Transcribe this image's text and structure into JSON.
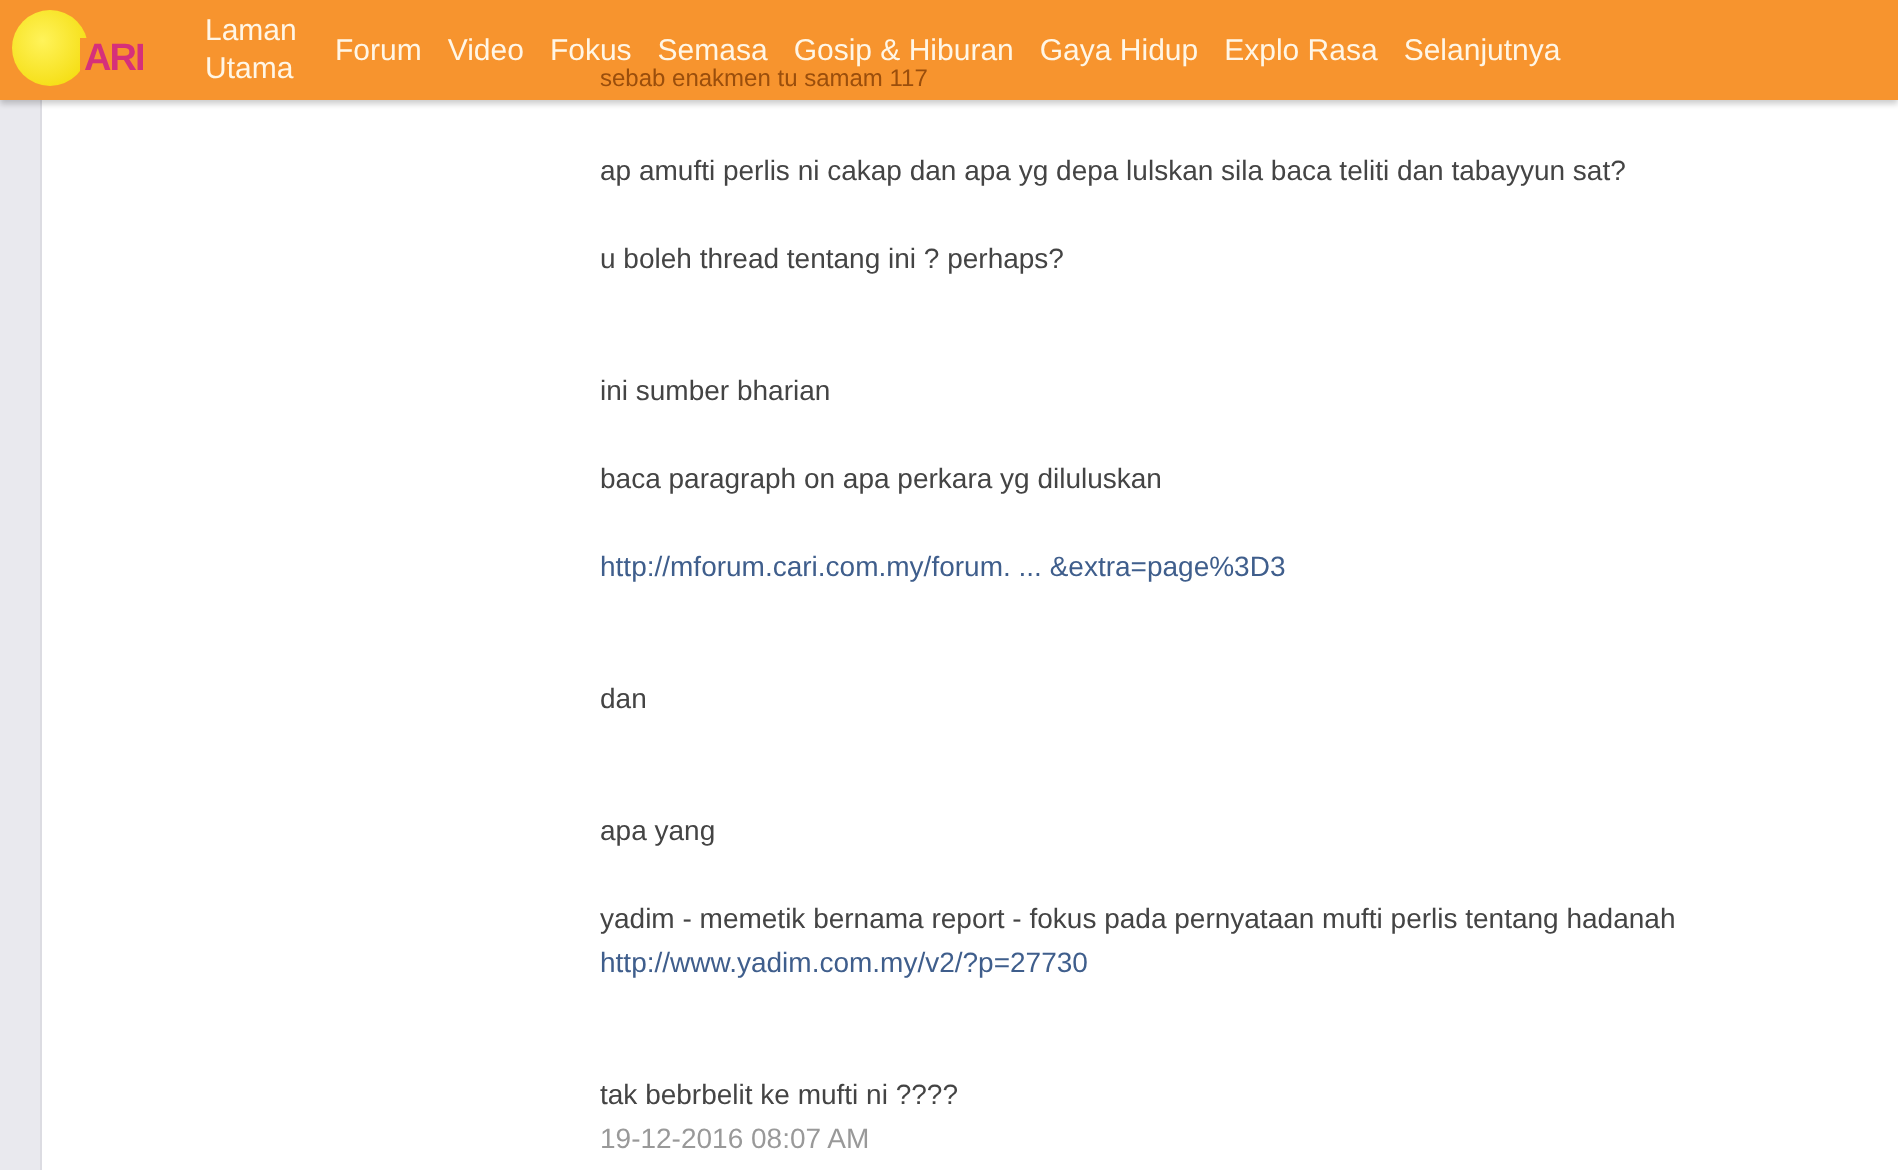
{
  "header": {
    "logo_text": "ARI",
    "nav": [
      {
        "label": "Laman Utama"
      },
      {
        "label": "Forum"
      },
      {
        "label": "Video"
      },
      {
        "label": "Fokus"
      },
      {
        "label": "Semasa"
      },
      {
        "label": "Gosip & Hiburan"
      },
      {
        "label": "Gaya Hidup"
      },
      {
        "label": "Explo Rasa"
      },
      {
        "label": "Selanjutnya"
      }
    ],
    "underlay_text": "sebab enakmen tu samam 117"
  },
  "post": {
    "lines": [
      {
        "kind": "text",
        "text": "ap amufti perlis  ni cakap dan apa yg depa lulskan sila baca teliti dan tabayyun sat?"
      },
      {
        "kind": "blank"
      },
      {
        "kind": "text",
        "text": "u boleh thread tentang ini ? perhaps?"
      },
      {
        "kind": "blank"
      },
      {
        "kind": "blank"
      },
      {
        "kind": "text",
        "text": "ini sumber bharian"
      },
      {
        "kind": "blank"
      },
      {
        "kind": "text",
        "text": "baca paragraph on apa perkara yg diluluskan"
      },
      {
        "kind": "blank"
      },
      {
        "kind": "link",
        "text": "http://mforum.cari.com.my/forum. ... &extra=page%3D3"
      },
      {
        "kind": "blank"
      },
      {
        "kind": "blank"
      },
      {
        "kind": "text",
        "text": "dan"
      },
      {
        "kind": "blank"
      },
      {
        "kind": "blank"
      },
      {
        "kind": "text",
        "text": "apa  yang"
      },
      {
        "kind": "blank"
      },
      {
        "kind": "text",
        "text": "yadim - memetik bernama report - fokus pada pernyataan mufti perlis tentang hadanah"
      },
      {
        "kind": "link",
        "text": "http://www.yadim.com.my/v2/?p=27730"
      },
      {
        "kind": "blank"
      },
      {
        "kind": "blank"
      },
      {
        "kind": "text",
        "text": "tak bebrbelit ke mufti ni ????"
      },
      {
        "kind": "date",
        "text": "19-12-2016 08:07 AM"
      }
    ]
  }
}
